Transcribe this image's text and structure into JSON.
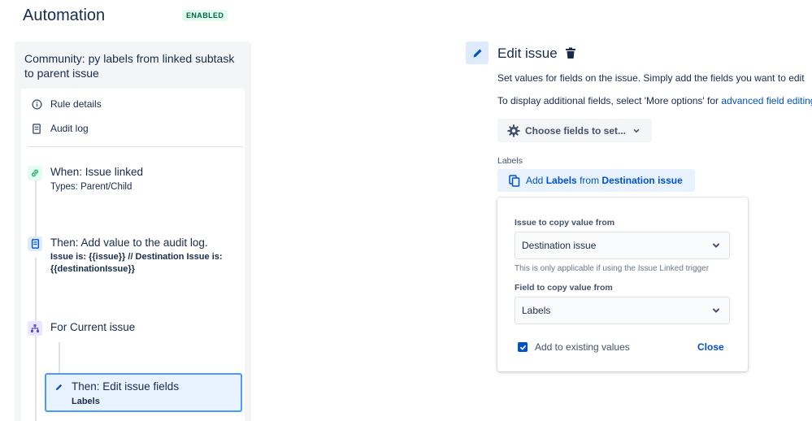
{
  "header": {
    "title": "Automation",
    "status_badge": "ENABLED"
  },
  "rule": {
    "name": "Community: py labels from linked subtask to parent issue",
    "menu": {
      "rule_details": "Rule details",
      "audit_log": "Audit log"
    },
    "steps": [
      {
        "title": "When: Issue linked",
        "subtitle": "Types: Parent/Child"
      },
      {
        "title": "Then: Add value to the audit log.",
        "subtitle": "Issue is: {{issue}} // Destination Issue is: {{destinationIssue}}"
      },
      {
        "title": "For Current issue"
      },
      {
        "title": "Then: Edit issue fields",
        "subtitle": "Labels"
      }
    ]
  },
  "editor": {
    "title": "Edit issue",
    "description": "Set values for fields on the issue. Simply add the fields you want to edit",
    "more_options_prefix": "To display additional fields, select 'More options' for ",
    "more_options_link": "advanced field editing",
    "choose_fields_button": "Choose fields to set...",
    "labels_field_label": "Labels",
    "add_labels": {
      "prefix": "Add ",
      "field": "Labels",
      "middle": " from ",
      "source": "Destination issue"
    },
    "popup": {
      "issue_label": "Issue to copy value from",
      "issue_value": "Destination issue",
      "helper": "This is only applicable if using the Issue Linked trigger",
      "field_label": "Field to copy value from",
      "field_value": "Labels",
      "checkbox_label": "Add to existing values",
      "checkbox_checked": true,
      "close": "Close"
    }
  },
  "colors": {
    "accent": "#0052cc",
    "selected_border": "#4c9aff",
    "enabled_bg": "#e3fcef",
    "enabled_text": "#006644"
  }
}
